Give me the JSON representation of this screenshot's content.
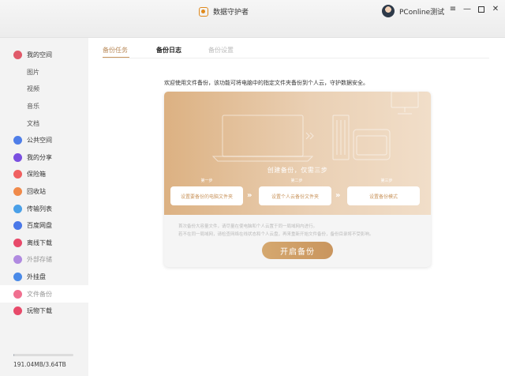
{
  "app": {
    "title": "数据守护者",
    "user_name": "PConline测试"
  },
  "window_controls": {
    "minimize": "—",
    "close": "✕"
  },
  "sidebar": {
    "items": [
      {
        "label": "我的空间",
        "icon": "my-space-icon",
        "color": "#e05a6a"
      },
      {
        "label": "图片"
      },
      {
        "label": "视频"
      },
      {
        "label": "音乐"
      },
      {
        "label": "文档"
      },
      {
        "label": "公共空间",
        "icon": "public-space-icon",
        "color": "#4f7ee8"
      },
      {
        "label": "我的分享",
        "icon": "share-icon",
        "color": "#7a4fe0"
      },
      {
        "label": "保险箱",
        "icon": "safe-icon",
        "color": "#f06060"
      },
      {
        "label": "回收站",
        "icon": "recycle-bin-icon",
        "color": "#f08a4a"
      },
      {
        "label": "传输列表",
        "icon": "transfer-icon",
        "color": "#4aa0e8"
      },
      {
        "label": "百度网盘",
        "icon": "baidu-pan-icon",
        "color": "#4a78e8"
      },
      {
        "label": "离线下载",
        "icon": "offline-download-icon",
        "color": "#e84a6a"
      },
      {
        "label": "外部存储",
        "icon": "external-storage-icon",
        "color": "#b08ae0"
      },
      {
        "label": "外挂盘",
        "icon": "external-disk-icon",
        "color": "#4a8ae8"
      },
      {
        "label": "文件备份",
        "icon": "file-backup-icon",
        "color": "#f07090"
      },
      {
        "label": "玩物下载",
        "icon": "wanwu-download-icon",
        "color": "#e84a6a"
      }
    ],
    "storage": {
      "used_label": "191.04MB/3.64TB",
      "used_fraction": 5e-05
    }
  },
  "tabs": [
    {
      "label": "备份任务"
    },
    {
      "label": "备份日志"
    },
    {
      "label": "备份设置"
    }
  ],
  "main": {
    "intro": "欢迎使用文件备份，该功能可将电脑中的指定文件夹备份到个人云，守护数据安全。",
    "banner_title": "创建备份，仅需三步",
    "steps": [
      {
        "label": "第一步",
        "button": "设置要备份的电脑文件夹"
      },
      {
        "label": "第二步",
        "button": "设置个人云备份文件夹"
      },
      {
        "label": "第三步",
        "button": "设置备份模式"
      }
    ],
    "description_line1": "首次备份大容量文件，请尽量在使电脑和个人云置于同一局域网内进行。",
    "description_line2": "若不在同一局域网，请检查网络在线状态和个人云盘，再来重新开始文件备份，备份目录将不受影响。",
    "start_button": "开启备份"
  },
  "colors": {
    "accent": "#c9955e",
    "sidebar_bg": "#f3f3f3"
  }
}
